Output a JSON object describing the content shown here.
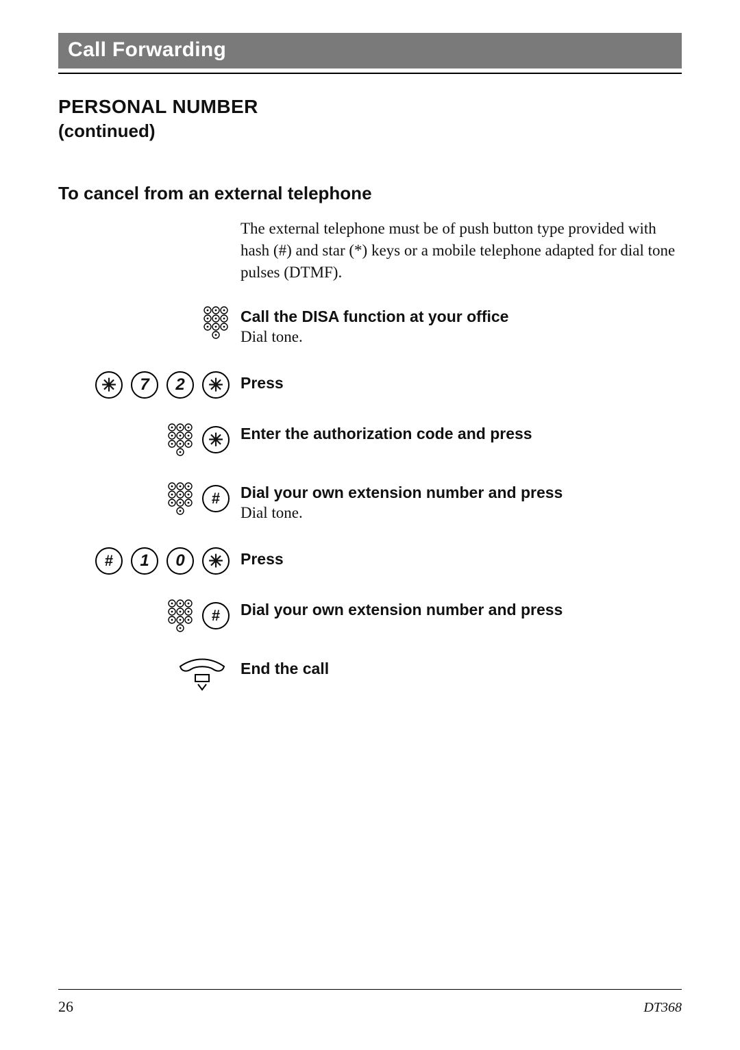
{
  "section": "Call Forwarding",
  "heading": "PERSONAL NUMBER",
  "heading_sub": "(continued)",
  "subheading": "To cancel from an external telephone",
  "intro": "The external telephone must be of push button type provided with hash (#) and star (*) keys or a mobile telephone adapted for dial tone pulses (DTMF).",
  "steps": [
    {
      "iconset": "keypad",
      "title": "Call the DISA function at your office",
      "body": "Dial tone."
    },
    {
      "iconset": "keys",
      "keys": [
        "*",
        "7",
        "2",
        "*"
      ],
      "title": "Press",
      "body": ""
    },
    {
      "iconset": "keypad_key",
      "keys": [
        "*"
      ],
      "title": "Enter the authorization code and press",
      "body": ""
    },
    {
      "iconset": "keypad_key",
      "keys": [
        "#"
      ],
      "title": "Dial your own extension number and press",
      "body": "Dial tone."
    },
    {
      "iconset": "keys",
      "keys": [
        "#",
        "1",
        "0",
        "*"
      ],
      "title": "Press",
      "body": ""
    },
    {
      "iconset": "keypad_key",
      "keys": [
        "#"
      ],
      "title": "Dial your own extension number and press",
      "body": ""
    },
    {
      "iconset": "handset",
      "title": "End the call",
      "body": ""
    }
  ],
  "footer": {
    "page": "26",
    "model": "DT368"
  }
}
